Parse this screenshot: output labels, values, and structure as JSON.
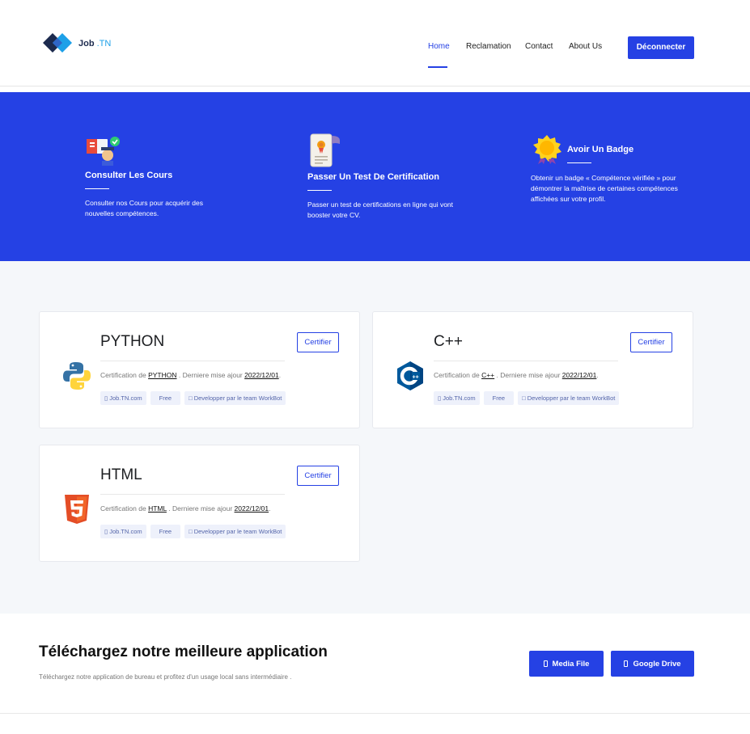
{
  "header": {
    "logo": {
      "brand": "Job",
      "suffix": ".TN"
    },
    "nav": [
      {
        "label": "Home",
        "active": true
      },
      {
        "label": "Reclamation",
        "active": false
      },
      {
        "label": "Contact",
        "active": false
      },
      {
        "label": "About Us",
        "active": false
      }
    ],
    "logout_label": "Déconnecter"
  },
  "features": [
    {
      "icon": "student-books-icon",
      "title": "Consulter Les Cours",
      "text": "Consulter nos Cours pour acquérir des nouvelles compétences."
    },
    {
      "icon": "certificate-scroll-icon",
      "title": "Passer Un Test De Certification",
      "text": "Passer un test de certifications en ligne qui vont booster votre CV."
    },
    {
      "icon": "gold-badge-icon",
      "title": "Avoir Un Badge",
      "text": "Obtenir un badge « Compétence vérifiée » pour démontrer la maîtrise de certaines compétences affichées sur votre profil."
    }
  ],
  "courses": [
    {
      "title": "PYTHON",
      "icon": "python-logo-icon",
      "desc_prefix": "Certification de",
      "course_link": "PYTHON",
      "desc_mid": ". Derniere mise ajour",
      "date": "2022/12/01",
      "desc_suffix": ".",
      "tags": [
        "Job.TN.com",
        "Free",
        "Developper par le team WorkBot"
      ],
      "button": "Certifier"
    },
    {
      "title": "C++",
      "icon": "cpp-logo-icon",
      "desc_prefix": "Certification de",
      "course_link": "C++",
      "desc_mid": ". Derniere mise ajour",
      "date": "2022/12/01",
      "desc_suffix": ".",
      "tags": [
        "Job.TN.com",
        "Free",
        "Developper par le team WorkBot"
      ],
      "button": "Certifier"
    },
    {
      "title": "HTML",
      "icon": "html5-logo-icon",
      "desc_prefix": "Certification de",
      "course_link": "HTML",
      "desc_mid": ". Derniere mise ajour",
      "date": "2022/12/01",
      "desc_suffix": ".",
      "tags": [
        "Job.TN.com",
        "Free",
        "Developper par le team WorkBot"
      ],
      "button": "Certifier"
    }
  ],
  "download": {
    "title": "Téléchargez notre meilleure application",
    "subtitle": "Téléchargez notre application de bureau et profitez d'un usage local sans intermédiaire .",
    "buttons": [
      "Media File",
      "Google Drive"
    ]
  },
  "colors": {
    "primary": "#2541e4",
    "section_bg": "#f5f7fa"
  }
}
